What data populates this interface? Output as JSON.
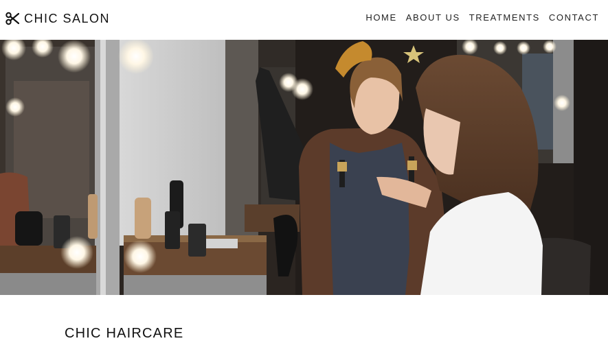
{
  "brand": {
    "name": "CHIC SALON",
    "icon": "scissors-icon"
  },
  "nav": {
    "items": [
      {
        "label": "HOME"
      },
      {
        "label": "ABOUT US"
      },
      {
        "label": "TREATMENTS"
      },
      {
        "label": "CONTACT"
      }
    ]
  },
  "hero": {
    "image": "salon-stylist-consultation-photo"
  },
  "section": {
    "title": "CHIC HAIRCARE"
  },
  "colors": {
    "text": "#111111",
    "background": "#ffffff"
  }
}
